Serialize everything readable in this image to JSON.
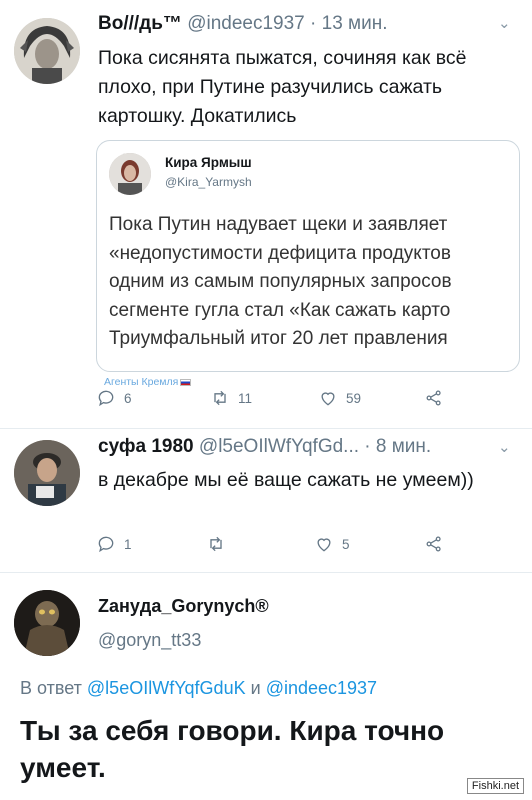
{
  "tweet1": {
    "name": "Во///дь™",
    "handle": "@indeec1937",
    "time": "· 13 мин.",
    "text": "Пока сисянята пыжатся, сочиняя как всё плохо, при Путине разучились сажать картошку. Докатились",
    "quote": {
      "name": "Кира Ярмыш",
      "handle": "@Kira_Yarmysh",
      "lines": [
        "Пока Путин надувает щеки и заявляет",
        "«недопустимости дефицита продуктов",
        "одним из самым популярных запросов",
        "сегменте гугла стал «Как сажать карто",
        "Триумфальный итог 20 лет правления"
      ]
    },
    "watermark": "Агенты Кремля",
    "actions": {
      "replies": "6",
      "retweets": "11",
      "likes": "59"
    }
  },
  "tweet2": {
    "name": "суфа 1980",
    "handle": "@l5eOIlWfYqfGd...",
    "time": "· 8 мин.",
    "text": "в декабре мы её ваще сажать не умеем))",
    "actions": {
      "replies": "1",
      "retweets": "",
      "likes": "5"
    }
  },
  "tweet3": {
    "name": "Zанyда_Gorynych®",
    "handle": "@goryn_tt33",
    "reply_prefix": "В ответ",
    "reply_user1": "@l5eOIlWfYqfGduK",
    "reply_and": "и",
    "reply_user2": "@indeec1937",
    "text": "Ты за себя говори. Кира точно умеет."
  },
  "site_watermark": "Fishki.net",
  "colors": {
    "link": "#1b95e0",
    "muted": "#657786",
    "text": "#14171a",
    "border": "#ccd6dd"
  }
}
